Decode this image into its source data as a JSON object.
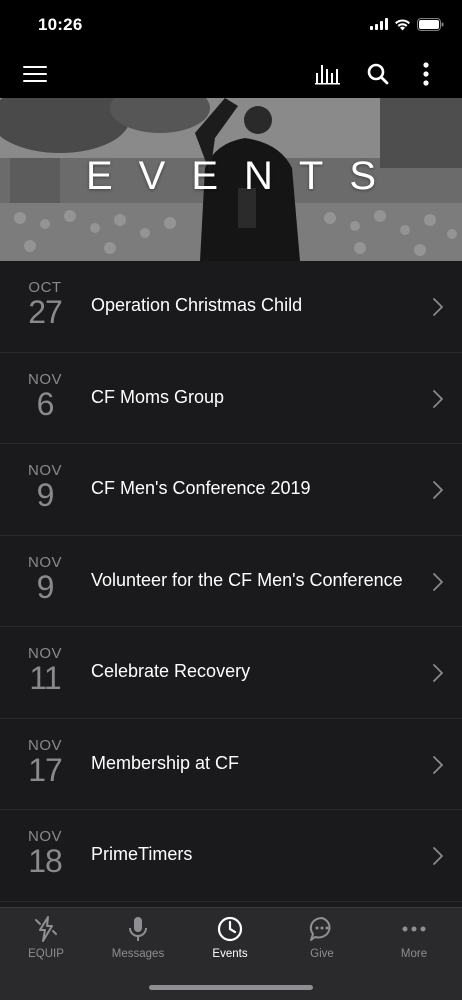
{
  "status_bar": {
    "time": "10:26"
  },
  "nav": {
    "menu_icon": "hamburger-menu-icon",
    "audio_icon": "audio-bars-icon",
    "search_icon": "search-icon",
    "more_icon": "vertical-dots-icon"
  },
  "hero": {
    "title": "EVENTS"
  },
  "events": [
    {
      "month": "OCT",
      "day": "27",
      "title": "Operation Christmas Child"
    },
    {
      "month": "NOV",
      "day": "6",
      "title": "CF Moms Group"
    },
    {
      "month": "NOV",
      "day": "9",
      "title": "CF Men's Conference 2019"
    },
    {
      "month": "NOV",
      "day": "9",
      "title": "Volunteer for the CF Men's Conference"
    },
    {
      "month": "NOV",
      "day": "11",
      "title": "Celebrate Recovery"
    },
    {
      "month": "NOV",
      "day": "17",
      "title": "Membership at CF"
    },
    {
      "month": "NOV",
      "day": "18",
      "title": "PrimeTimers"
    }
  ],
  "tabs": [
    {
      "label": "EQUIP",
      "icon": "lightning-icon",
      "active": false
    },
    {
      "label": "Messages",
      "icon": "microphone-icon",
      "active": false
    },
    {
      "label": "Events",
      "icon": "clock-icon",
      "active": true
    },
    {
      "label": "Give",
      "icon": "chat-bubble-icon",
      "active": false
    },
    {
      "label": "More",
      "icon": "horizontal-dots-icon",
      "active": false
    }
  ],
  "colors": {
    "list_bg": "#1a1a1c",
    "tab_bar_bg": "#2a2a2c",
    "muted": "#8a8a8e",
    "active": "#ffffff"
  }
}
